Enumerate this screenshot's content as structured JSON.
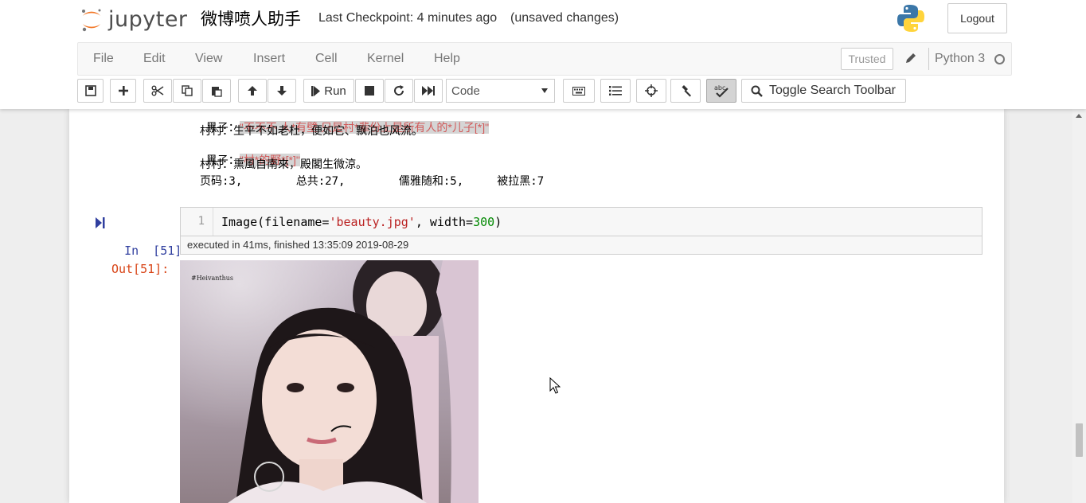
{
  "header": {
    "logo_text": "jupyter",
    "notebook_title": "微博喷人助手",
    "checkpoint": "Last Checkpoint: 4 minutes ago",
    "status": "(unsaved changes)",
    "logout_label": "Logout"
  },
  "menu": {
    "items": [
      "File",
      "Edit",
      "View",
      "Insert",
      "Cell",
      "Kernel",
      "Help"
    ],
    "trusted": "Trusted",
    "kernel": "Python 3"
  },
  "toolbar": {
    "run_label": "Run",
    "cell_type": "Code",
    "search_label": "Toggle Search Toolbar",
    "spell_label": "abc"
  },
  "output_text": {
    "line1_prefix": "黑子：",
    "line1_highlight": "\"不不不 人*有壁 只是村*辈份上是所有人的*儿子[*]\"",
    "line2": "村村：生平不如老杜，便如它、飘泊也风流。",
    "line3_prefix": "黑子：",
    "line3_highlight": "\"村*的野*[*]\"",
    "line4": "村村：熏風自南來，殿閣生微涼。",
    "stats": "页码:3,        总共:27,        儒雅随和:5,     被拉黑:7"
  },
  "cell": {
    "prompt_in": "In  [51]:",
    "line_number": "1",
    "code": {
      "func": "Image(filename=",
      "str": "'beauty.jpg'",
      "mid": ", width=",
      "num": "300",
      "end": ")"
    },
    "exec_info": "executed in 41ms, finished 13:35:09 2019-08-29",
    "prompt_out": "Out[51]:",
    "image_watermark": "#Heivanthus"
  },
  "colors": {
    "prompt_in": "#303f9f",
    "prompt_out": "#d84315",
    "highlight_text": "#d15a5a",
    "highlight_bg": "#d5d5d5"
  }
}
